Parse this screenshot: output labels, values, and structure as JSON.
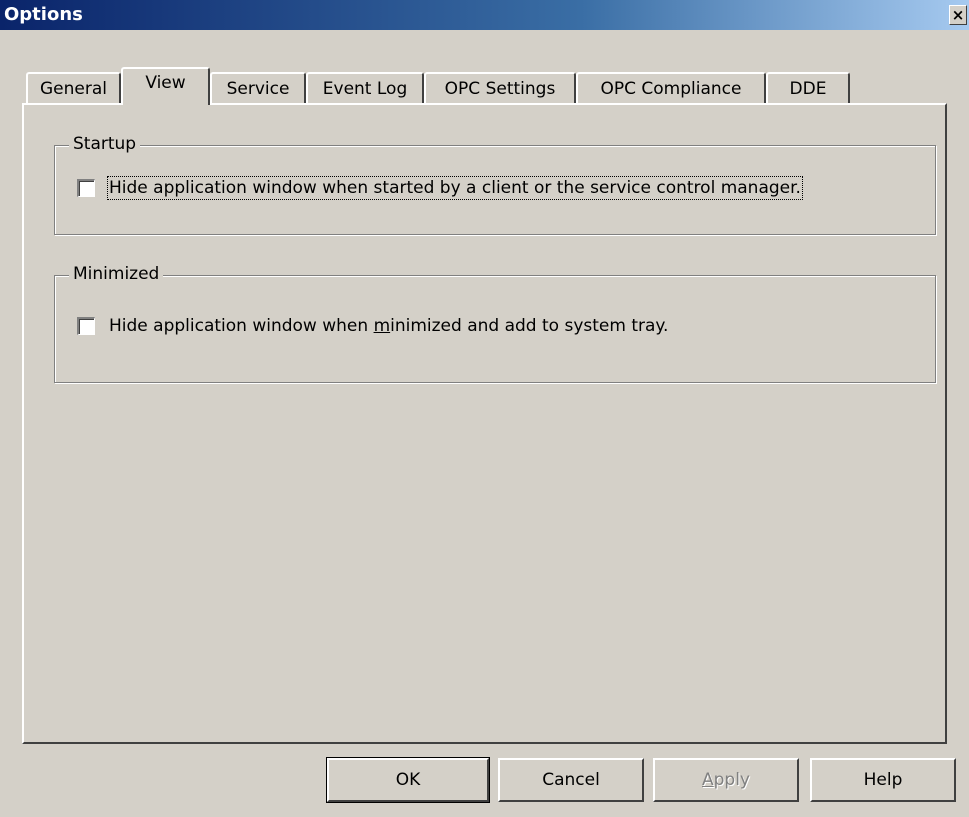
{
  "window": {
    "title": "Options"
  },
  "titlebar": {
    "close_glyph": "×"
  },
  "tabs": [
    {
      "label": "General",
      "active": false
    },
    {
      "label": "View",
      "active": true
    },
    {
      "label": "Service",
      "active": false
    },
    {
      "label": "Event Log",
      "active": false
    },
    {
      "label": "OPC Settings",
      "active": false
    },
    {
      "label": "OPC Compliance",
      "active": false
    },
    {
      "label": "DDE",
      "active": false
    }
  ],
  "startup": {
    "label": "Startup",
    "checkbox_label": "Hide application window when started by a client or the service control manager.",
    "checked": false
  },
  "minimized": {
    "label": "Minimized",
    "checkbox_label_pre": "Hide application window when ",
    "checkbox_label_accel": "m",
    "checkbox_label_post": "inimized and add to system tray.",
    "checked": false
  },
  "buttons": {
    "ok": "OK",
    "cancel": "Cancel",
    "apply_accel": "A",
    "apply_rest": "pply",
    "help": "Help"
  },
  "colors": {
    "face": "#d4d0c8",
    "title_start": "#0a246a",
    "title_end": "#a6caf0",
    "disabled_text": "#808080"
  }
}
